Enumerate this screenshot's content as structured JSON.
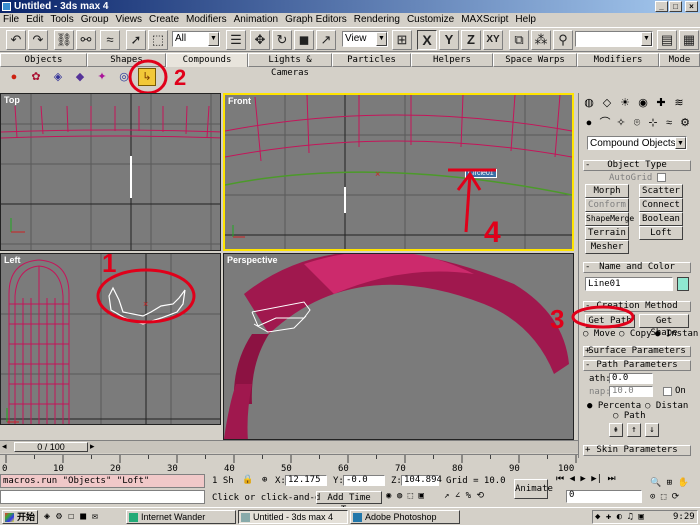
{
  "window": {
    "title": "Untitled - 3ds max 4",
    "btn_min": "_",
    "btn_max": "□",
    "btn_close": "×"
  },
  "menu": [
    "File",
    "Edit",
    "Tools",
    "Group",
    "Views",
    "Create",
    "Modifiers",
    "Animation",
    "Graph Editors",
    "Rendering",
    "Customize",
    "MAXScript",
    "Help"
  ],
  "toolbar": {
    "selection_filter": "All",
    "ref_coord": "View",
    "axis_x": "X",
    "axis_y": "Y",
    "axis_z": "Z",
    "axis_xy": "XY"
  },
  "tabs": [
    "Objects",
    "Shapes",
    "Compounds",
    "Lights & Cameras",
    "Particles",
    "Helpers",
    "Space Warps",
    "Modifiers",
    "Mode"
  ],
  "active_tab": "Compounds",
  "viewports": {
    "top": "Top",
    "front": "Front",
    "left": "Left",
    "perspective": "Perspective"
  },
  "front_object_label": "Circle01",
  "annotations": {
    "one": "1",
    "two": "2",
    "three": "3",
    "four": "4"
  },
  "command_panel": {
    "category": "Compound Objects",
    "object_type_header": "Object Type",
    "autogrid_label": "AutoGrid",
    "object_buttons": [
      "Morph",
      "Scatter",
      "Conform",
      "Connect",
      "ShapeMerge",
      "Boolean",
      "Terrain",
      "Loft",
      "Mesher"
    ],
    "name_color_header": "Name and Color",
    "object_name": "Line01",
    "object_color": "#8fe8d0",
    "creation_method_header": "Creation Method",
    "get_path": "Get Path",
    "get_shape": "Get Shape",
    "move": "Move",
    "copy": "Copy",
    "instance": "Instan",
    "surface_params": "Surface Parameters",
    "path_params": "Path Parameters",
    "path_label": "ath:",
    "path_value": "0.0",
    "snap_label": "nap:",
    "snap_value": "10.0",
    "on_label": "On",
    "percentage": "Percenta",
    "distance": "Distan",
    "path_steps": "Path",
    "skin_params": "Skin Parameters"
  },
  "timeline": {
    "frame_display": "0 / 100",
    "ruler_ticks": [
      "0",
      "10",
      "20",
      "30",
      "40",
      "50",
      "60",
      "70",
      "80",
      "90",
      "100"
    ]
  },
  "status": {
    "maxscript": "macros.run \"Objects\" \"Loft\"",
    "selection": "1 Sh",
    "x_label": "X:",
    "x_value": "12.175",
    "y_label": "Y:",
    "y_value": "-0.0",
    "z_label": "Z:",
    "z_value": "104.894",
    "grid": "Grid = 10.0",
    "prompt": "Click or click-and-d",
    "add_time_tag": "Add Time Tag",
    "animate": "Animate",
    "frame": "0"
  },
  "taskbar": {
    "start": "开始",
    "tasks": [
      "Internet Wander",
      "Untitled - 3ds max 4",
      "Adobe Photoshop"
    ],
    "clock": "9:29"
  }
}
